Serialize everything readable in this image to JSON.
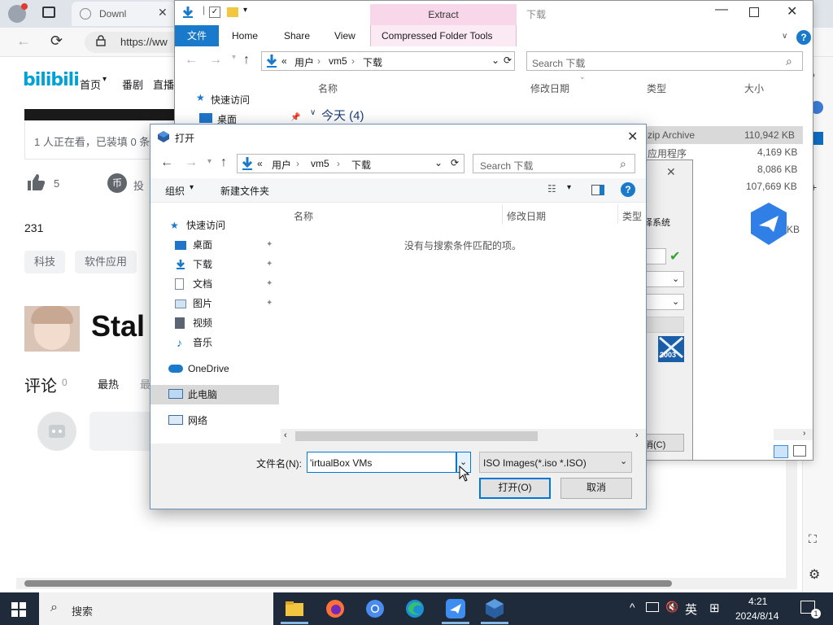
{
  "browser": {
    "tab_title": "Downl",
    "url_text": "https://ww",
    "site_logo": "bilibili",
    "nav_items": [
      "首页",
      "番剧",
      "直播"
    ],
    "watching_text": "1 人正在看，已装填 0 条",
    "like_count": "5",
    "coin_label": "投",
    "count_231": "231",
    "tags": [
      "科技",
      "软件应用"
    ],
    "video_title_fragment": "Stal",
    "comments_label": "评论",
    "comments_count": "0",
    "sort_hot": "最热",
    "sort_fragment": "最"
  },
  "explorer": {
    "title": "下载",
    "ribbon_tabs": [
      "文件",
      "Home",
      "Share",
      "View"
    ],
    "extract_tab": "Extract",
    "compressed_tab": "Compressed Folder Tools",
    "path": [
      "«",
      "用户",
      "vm5",
      "下载"
    ],
    "search_placeholder": "Search 下载",
    "columns": {
      "name": "名称",
      "date": "修改日期",
      "type": "类型",
      "size": "大小"
    },
    "group_label": "今天 (4)",
    "sidebar": [
      {
        "label": "快速访问"
      },
      {
        "label": "桌面"
      }
    ],
    "rows": [
      {
        "type": "zip Archive",
        "size": "110,942 KB"
      },
      {
        "type": "应用程序",
        "size": "4,169 KB"
      },
      {
        "type": "",
        "size": "8,086 KB"
      },
      {
        "type": "",
        "size": "107,669 KB"
      }
    ],
    "partial_kb": "KB"
  },
  "back_dialog": {
    "text_fragment": "择系统",
    "button_fragment": "消(C)",
    "logo_text": "2003"
  },
  "dialog": {
    "title": "打开",
    "path": [
      "«",
      "用户",
      "vm5",
      "下载"
    ],
    "search_placeholder": "Search 下载",
    "organize_label": "组织",
    "new_folder_label": "新建文件夹",
    "columns": {
      "name": "名称",
      "date": "修改日期",
      "type": "类型"
    },
    "empty_text": "没有与搜索条件匹配的项。",
    "nav": [
      {
        "label": "快速访问",
        "icon": "star-icon",
        "pinned": false
      },
      {
        "label": "桌面",
        "icon": "desktop-icon",
        "pinned": true
      },
      {
        "label": "下载",
        "icon": "download-icon",
        "pinned": true
      },
      {
        "label": "文档",
        "icon": "document-icon",
        "pinned": true
      },
      {
        "label": "图片",
        "icon": "pictures-icon",
        "pinned": true
      },
      {
        "label": "视频",
        "icon": "video-icon",
        "pinned": false
      },
      {
        "label": "音乐",
        "icon": "music-icon",
        "pinned": false
      },
      {
        "label": "OneDrive",
        "icon": "cloud-icon",
        "pinned": false
      },
      {
        "label": "此电脑",
        "icon": "computer-icon",
        "pinned": false,
        "selected": true
      },
      {
        "label": "网络",
        "icon": "network-icon",
        "pinned": false
      }
    ],
    "filename_label": "文件名(N):",
    "filename_value": "'irtualBox VMs",
    "filetype_value": "ISO Images(*.iso *.ISO)",
    "open_button": "打开(O)",
    "cancel_button": "取消"
  },
  "taskbar": {
    "search_label": "搜索",
    "ime_label": "英",
    "time": "4:21",
    "date": "2024/8/14",
    "notification_count": "1"
  },
  "colors": {
    "accent": "#0078d7",
    "bilibili": "#00a1d6",
    "ribbon_file": "#1979ca",
    "extract_tab": "#f9d7ea",
    "taskbar": "#1f2b3a"
  }
}
